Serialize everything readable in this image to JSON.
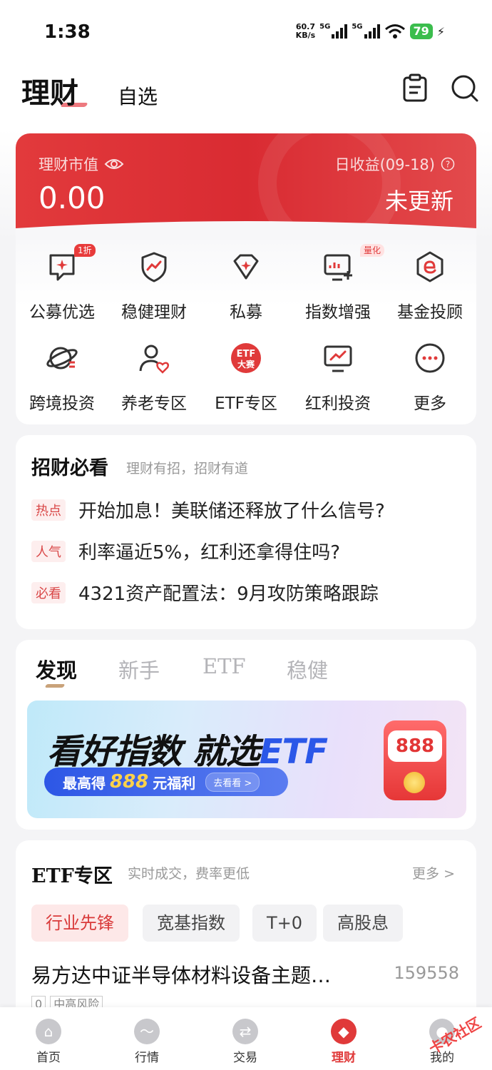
{
  "status_bar": {
    "time": "1:38",
    "net_speed_value": "60.7",
    "net_speed_unit": "KB/s",
    "sig1": "5G",
    "sig2": "5G",
    "battery": "79"
  },
  "top_nav": {
    "main": "理财",
    "secondary": "自选",
    "icons": [
      "task-list-icon",
      "search-icon"
    ]
  },
  "hero": {
    "market_value_label": "理财市值",
    "market_value": "0.00",
    "daily_income_label": "日收益(09-18)",
    "daily_income_value": "未更新",
    "colors": {
      "primary": "#d92b32"
    }
  },
  "grid": [
    {
      "label": "公募优选",
      "icon": "flag-icon",
      "badge": "1折"
    },
    {
      "label": "稳健理财",
      "icon": "shield-chart-icon",
      "badge": ""
    },
    {
      "label": "私募",
      "icon": "diamond-icon",
      "badge": ""
    },
    {
      "label": "指数增强",
      "icon": "monitor-plus-icon",
      "badge": "量化"
    },
    {
      "label": "基金投顾",
      "icon": "hexagon-e-icon",
      "badge": ""
    },
    {
      "label": "跨境投资",
      "icon": "planet-icon",
      "badge": ""
    },
    {
      "label": "养老专区",
      "icon": "person-heart-icon",
      "badge": ""
    },
    {
      "label": "ETF专区",
      "icon": "etf-contest-icon",
      "badge": "",
      "icon_text": [
        "ETF",
        "大赛"
      ]
    },
    {
      "label": "红利投资",
      "icon": "monitor-trend-icon",
      "badge": ""
    },
    {
      "label": "更多",
      "icon": "more-icon",
      "badge": ""
    }
  ],
  "must_read": {
    "title": "招财必看",
    "subtitle": "理财有招，招财有道",
    "items": [
      {
        "tag": "热点",
        "text": "开始加息！美联储还释放了什么信号?"
      },
      {
        "tag": "人气",
        "text": "利率逼近5%，红利还拿得住吗?"
      },
      {
        "tag": "必看",
        "text": "4321资产配置法：9月攻防策略跟踪"
      }
    ]
  },
  "discover": {
    "tabs": [
      "发现",
      "新手",
      "ETF",
      "稳健"
    ],
    "active_tab": "发现",
    "banner": {
      "title_a": "看好指数 就选",
      "title_b": "ETF",
      "pill_prefix": "最高得",
      "pill_number": "888",
      "pill_suffix": "元福利",
      "pill_button": "去看看 >",
      "envelope_number": "888"
    }
  },
  "etf_zone": {
    "title": "ETF专区",
    "subtitle": "实时成交，费率更低",
    "more": "更多 >",
    "chips": [
      "行业先锋",
      "宽基指数",
      "T+0",
      "高股息"
    ],
    "active_chip": "行业先锋",
    "fund": {
      "name": "易方达中证半导体材料设备主题…",
      "code": "159558",
      "tags": [
        "0",
        "中高风险"
      ]
    }
  },
  "bottom_nav": {
    "items": [
      {
        "label": "首页",
        "icon": "home-icon",
        "active": false
      },
      {
        "label": "行情",
        "icon": "market-trend-icon",
        "active": false
      },
      {
        "label": "交易",
        "icon": "exchange-icon",
        "active": false
      },
      {
        "label": "理财",
        "icon": "wealth-diamond-icon",
        "active": true
      },
      {
        "label": "我的",
        "icon": "profile-icon",
        "active": false
      }
    ]
  },
  "watermark": "卡农社区"
}
